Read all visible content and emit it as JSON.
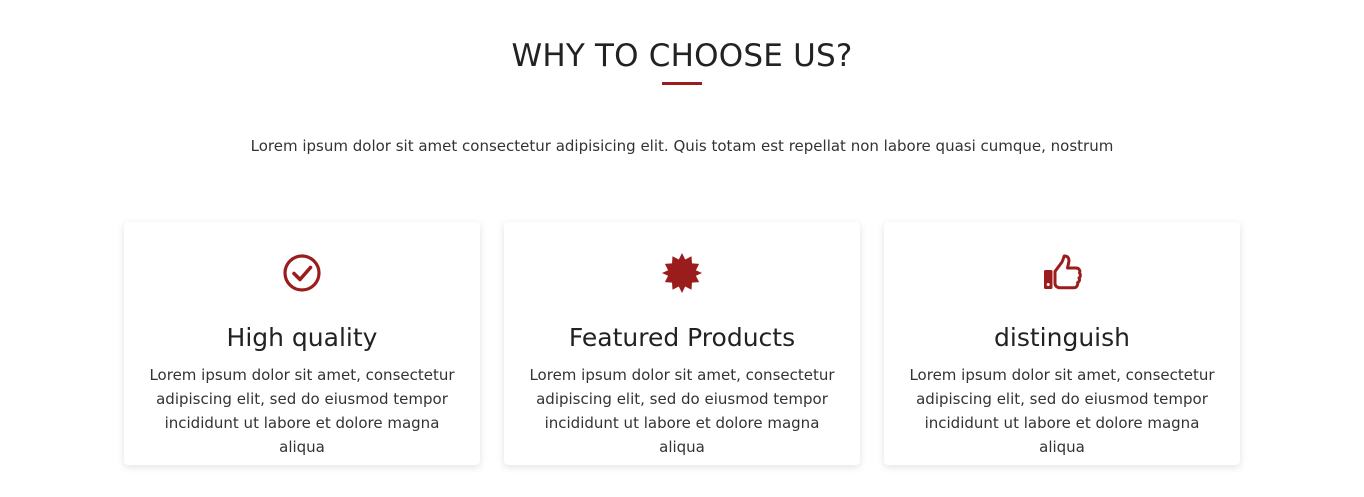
{
  "section": {
    "title": "WHY TO CHOOSE US?",
    "subtitle": "Lorem ipsum dolor sit amet consectetur adipisicing elit. Quis totam est repellat non labore quasi cumque, nostrum"
  },
  "theme": {
    "accent": "#9b1c1c"
  },
  "features": [
    {
      "icon": "check-circle-icon",
      "title": "High quality",
      "text": "Lorem ipsum dolor sit amet, consectetur adipiscing elit, sed do eiusmod tempor incididunt ut labore et dolore magna aliqua"
    },
    {
      "icon": "badge-certificate-icon",
      "title": "Featured Products",
      "text": "Lorem ipsum dolor sit amet, consectetur adipiscing elit, sed do eiusmod tempor incididunt ut labore et dolore magna aliqua"
    },
    {
      "icon": "thumbs-up-icon",
      "title": "distinguish",
      "text": "Lorem ipsum dolor sit amet, consectetur adipiscing elit, sed do eiusmod tempor incididunt ut labore et dolore magna aliqua"
    }
  ]
}
